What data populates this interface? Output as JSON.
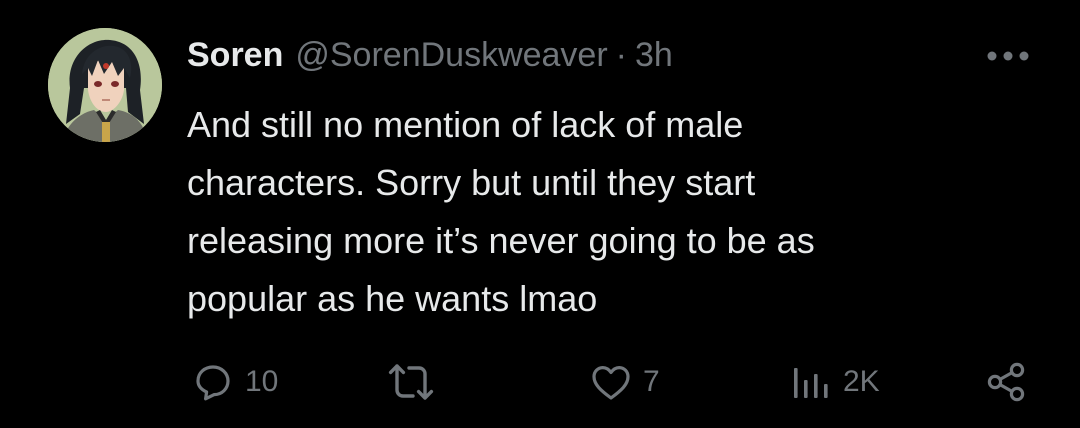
{
  "tweet": {
    "author": {
      "display_name": "Soren",
      "handle": "@SorenDuskweaver",
      "separator": "·",
      "time": "3h",
      "avatar_icon": "anime-character-avatar"
    },
    "more_icon": "more-horizontal-icon",
    "text_lines": [
      "And still no mention of lack of male",
      "characters. Sorry but until they start",
      "releasing more it’s never going to be as",
      "popular as he wants lmao"
    ],
    "actions": {
      "reply": {
        "icon": "reply-icon",
        "count": "10"
      },
      "retweet": {
        "icon": "retweet-icon",
        "count": ""
      },
      "like": {
        "icon": "like-icon",
        "count": "7"
      },
      "views": {
        "icon": "views-icon",
        "count": "2K"
      },
      "share": {
        "icon": "share-icon"
      }
    }
  },
  "colors": {
    "background": "#000000",
    "text_primary": "#e7e9ea",
    "text_secondary": "#71767b"
  }
}
